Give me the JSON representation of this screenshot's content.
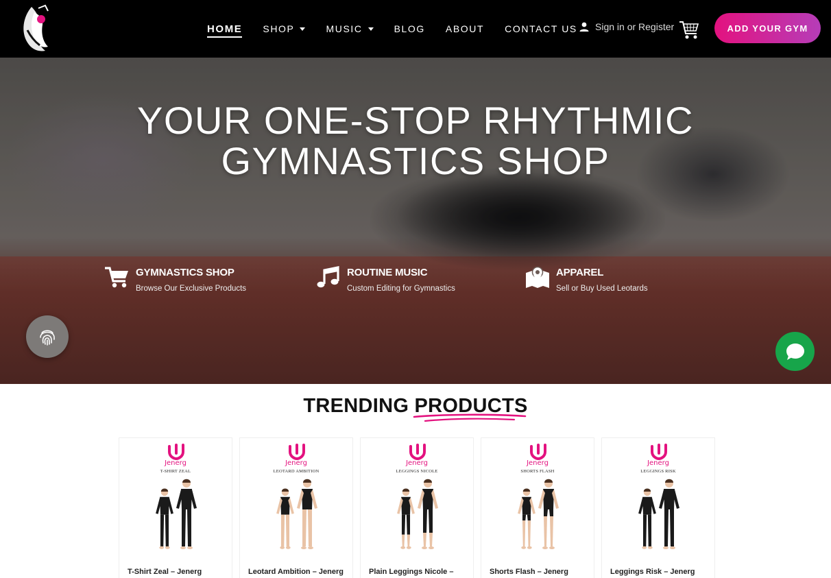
{
  "header": {
    "logo": "gymnast-logo",
    "nav": [
      {
        "label": "HOME",
        "active": true,
        "dropdown": false
      },
      {
        "label": "SHOP",
        "active": false,
        "dropdown": true
      },
      {
        "label": "MUSIC",
        "active": false,
        "dropdown": true
      },
      {
        "label": "BLOG",
        "active": false,
        "dropdown": false
      },
      {
        "label": "ABOUT",
        "active": false,
        "dropdown": false
      },
      {
        "label": "CONTACT US",
        "active": false,
        "dropdown": false
      }
    ],
    "signin": "Sign in or Register",
    "cta": "ADD YOUR GYM",
    "cta_colors": [
      "#e3127f",
      "#b63db8"
    ]
  },
  "hero": {
    "title_line1": "YOUR ONE-STOP RHYTHMIC",
    "title_line2": "GYMNASTICS SHOP",
    "features": [
      {
        "icon": "cart-icon",
        "title": "GYMNASTICS SHOP",
        "subtitle": "Browse Our Exclusive Products"
      },
      {
        "icon": "music-note-icon",
        "title": "ROUTINE MUSIC",
        "subtitle": "Custom Editing for Gymnastics"
      },
      {
        "icon": "map-pin-icon",
        "title": "APPAREL",
        "subtitle": "Sell or Buy Used Leotards"
      }
    ]
  },
  "widgets": {
    "fingerprint": "fingerprint-icon",
    "chat": "chat-bubble-icon",
    "chat_color": "#17a54a"
  },
  "trending": {
    "title_plain": "TRENDING",
    "title_highlight": "PRODUCTS",
    "accent": "#e3127f",
    "products": [
      {
        "brand": "Jenerg",
        "code": "T-SHIRT ZEAL",
        "name": "T-Shirt Zeal – Jenerg",
        "style": "tshirt"
      },
      {
        "brand": "Jenerg",
        "code": "LEOTARD AMBITION",
        "name": "Leotard Ambition – Jenerg",
        "style": "leotard"
      },
      {
        "brand": "Jenerg",
        "code": "LEGGINGS NICOLE",
        "name": "Plain Leggings Nicole –",
        "style": "leggings"
      },
      {
        "brand": "Jenerg",
        "code": "SHORTS FLASH",
        "name": "Shorts Flash – Jenerg",
        "style": "shorts"
      },
      {
        "brand": "Jenerg",
        "code": "LEGGINGS RISK",
        "name": "Leggings Risk – Jenerg",
        "style": "tshirt"
      }
    ]
  }
}
